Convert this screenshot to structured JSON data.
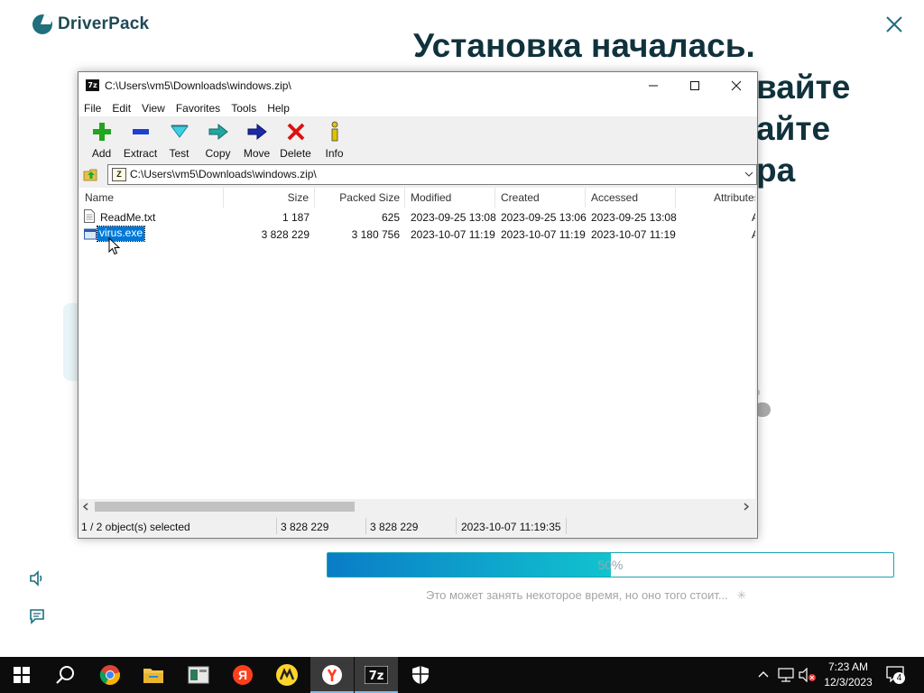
{
  "driverpack": {
    "logo_text": "DriverPack",
    "heading_line1": "Установка началась.",
    "heading_line2_fragment": "вайте",
    "heading_line3_fragment": "айте",
    "heading_line4_fragment": "ра",
    "progress_value": 50,
    "progress_label": "50%",
    "note": "Это может занять некоторое время, но оно того стоит..."
  },
  "window": {
    "title": "C:\\Users\\vm5\\Downloads\\windows.zip\\",
    "app_icon_text": "7z",
    "menu": [
      "File",
      "Edit",
      "View",
      "Favorites",
      "Tools",
      "Help"
    ],
    "toolbar": [
      {
        "label": "Add",
        "icon": "add-icon"
      },
      {
        "label": "Extract",
        "icon": "extract-icon"
      },
      {
        "label": "Test",
        "icon": "test-icon"
      },
      {
        "label": "Copy",
        "icon": "copy-icon"
      },
      {
        "label": "Move",
        "icon": "move-icon"
      },
      {
        "label": "Delete",
        "icon": "delete-icon"
      },
      {
        "label": "Info",
        "icon": "info-icon"
      }
    ],
    "address": "C:\\Users\\vm5\\Downloads\\windows.zip\\",
    "columns": [
      "Name",
      "Size",
      "Packed Size",
      "Modified",
      "Created",
      "Accessed",
      "Attributes"
    ],
    "files": [
      {
        "name": "ReadMe.txt",
        "size": "1 187",
        "packed": "625",
        "modified": "2023-09-25 13:08",
        "created": "2023-09-25 13:06",
        "accessed": "2023-09-25 13:08",
        "attributes": "A",
        "selected": false
      },
      {
        "name": "virus.exe",
        "size": "3 828 229",
        "packed": "3 180 756",
        "modified": "2023-10-07 11:19",
        "created": "2023-10-07 11:19",
        "accessed": "2023-10-07 11:19",
        "attributes": "A",
        "selected": true
      }
    ],
    "status": {
      "selection": "1 / 2 object(s) selected",
      "size": "3 828 229",
      "size2": "3 828 229",
      "modified": "2023-10-07 11:19:35"
    }
  },
  "taskbar": {
    "time": "7:23 AM",
    "date": "12/3/2023",
    "notification_count": "4",
    "apps": [
      "windows-start",
      "search",
      "chrome",
      "file-explorer",
      "app-window",
      "yandex",
      "yandex-market",
      "yandex-browser",
      "7-zip",
      "security"
    ]
  }
}
